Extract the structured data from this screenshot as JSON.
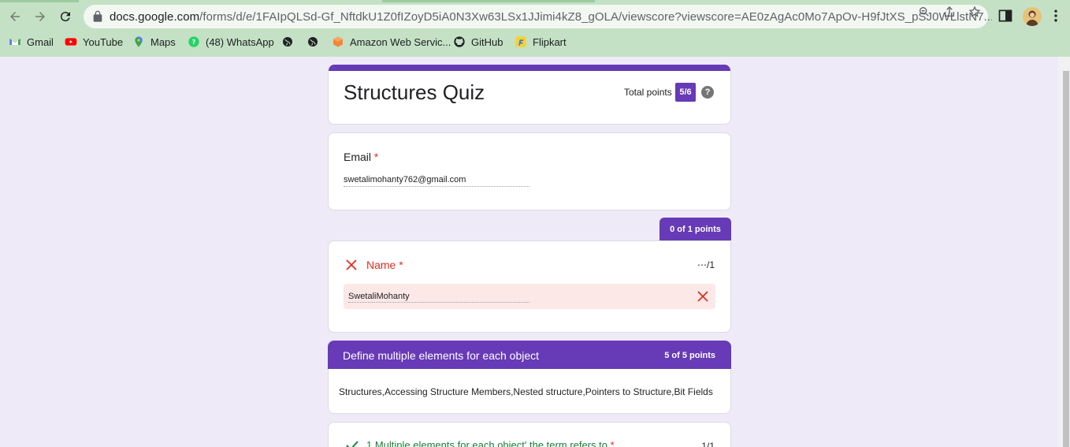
{
  "browser": {
    "url_host": "docs.google.com",
    "url_path": "/forms/d/e/1FAIpQLSd-Gf_NftdkU1Z0fIZoyD5iA0N3Xw63LSx1JJimi4kZ8_gOLA/viewscore?viewscore=AE0zAgAc0Mo7ApOv-H9fJtXS_pSJ0WLlstN7...",
    "bookmarks": [
      {
        "label": "Gmail",
        "icon": "gmail-icon"
      },
      {
        "label": "YouTube",
        "icon": "youtube-icon"
      },
      {
        "label": "Maps",
        "icon": "maps-icon"
      },
      {
        "label": "(48) WhatsApp",
        "icon": "whatsapp-icon"
      },
      {
        "label": "",
        "icon": "globe-icon"
      },
      {
        "label": "",
        "icon": "globe-icon"
      },
      {
        "label": "Amazon Web Servic...",
        "icon": "aws-icon"
      },
      {
        "label": "GitHub",
        "icon": "github-icon"
      },
      {
        "label": "Flipkart",
        "icon": "flipkart-icon"
      }
    ]
  },
  "form": {
    "title": "Structures Quiz",
    "total_points_label": "Total points",
    "total_score": "5/6",
    "help_glyph": "?",
    "accent_color": "#673ab7"
  },
  "email": {
    "label": "Email",
    "required_mark": "*",
    "value": "swetalimohanty762@gmail.com"
  },
  "name_question": {
    "points_tab": "0 of 1 points",
    "label": "Name",
    "required_mark": "*",
    "score": "⋯/1",
    "answer": "SwetaliMohanty",
    "status": "incorrect"
  },
  "section": {
    "title": "Define multiple elements for each object",
    "points": "5 of 5 points",
    "description": "Structures,Accessing Structure Members,Nested structure,Pointers to Structure,Bit Fields"
  },
  "question1": {
    "text": "1.Multiple elements for each object' the term refers to",
    "required_mark": "*",
    "score": "1/1",
    "status": "correct"
  }
}
